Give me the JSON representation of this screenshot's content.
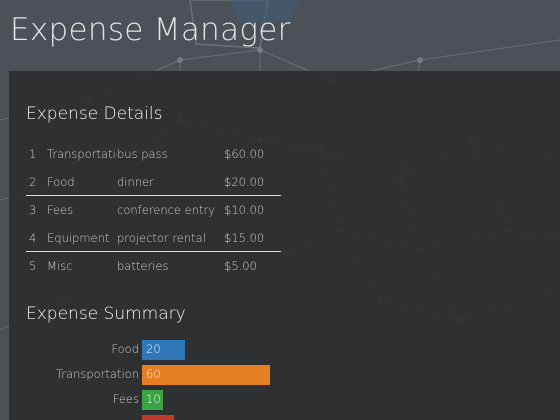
{
  "app": {
    "title": "Expense Manager"
  },
  "details": {
    "title": "Expense Details",
    "rows": [
      {
        "index": "1",
        "category": "Transportation",
        "description": "bus pass",
        "amount": "$60.00"
      },
      {
        "index": "2",
        "category": "Food",
        "description": "dinner",
        "amount": "$20.00"
      },
      {
        "index": "3",
        "category": "Fees",
        "description": "conference entry",
        "amount": "$10.00"
      },
      {
        "index": "4",
        "category": "Equipment",
        "description": "projector rental",
        "amount": "$15.00"
      },
      {
        "index": "5",
        "category": "Misc",
        "description": "batteries",
        "amount": "$5.00"
      }
    ]
  },
  "summary": {
    "title": "Expense Summary",
    "scale_max": 60,
    "bars": [
      {
        "label": "Food",
        "value": 20,
        "value_text": "20",
        "color": "#2e78b7"
      },
      {
        "label": "Transportation",
        "value": 60,
        "value_text": "60",
        "color": "#e67e22"
      },
      {
        "label": "Fees",
        "value": 10,
        "value_text": "10",
        "color": "#3aa344"
      },
      {
        "label": "",
        "value": 15,
        "value_text": "",
        "color": "#c0392b"
      }
    ]
  },
  "theme": {
    "panel_bg": "#2b2c2e",
    "background": "#4c5157",
    "text": "#c8c8c8",
    "divider": "#d8d8d8"
  }
}
